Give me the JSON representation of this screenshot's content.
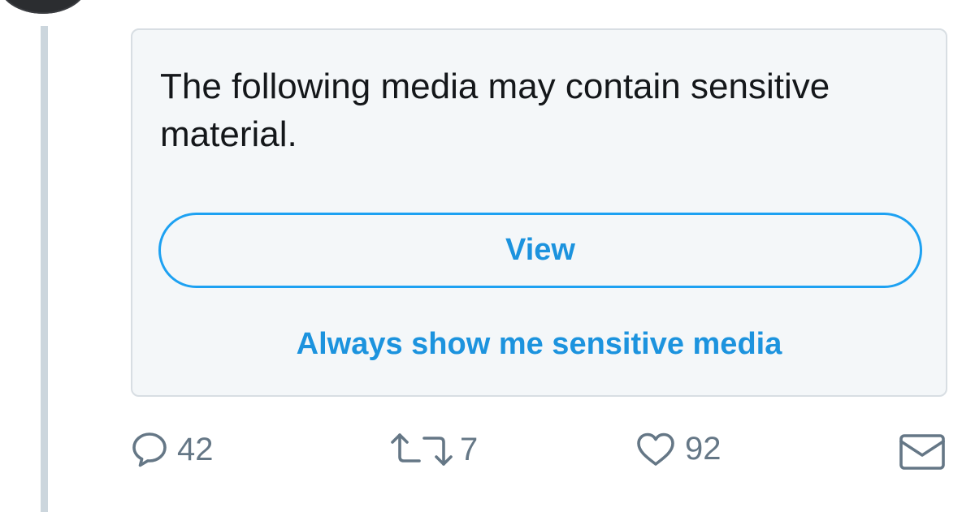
{
  "sensitive_notice": {
    "message": "The following media may contain sensitive material.",
    "view_label": "View",
    "always_show_label": "Always show me sensitive media"
  },
  "actions": {
    "reply": {
      "icon": "reply-icon",
      "count": "42"
    },
    "retweet": {
      "icon": "retweet-icon",
      "count": "7"
    },
    "like": {
      "icon": "heart-icon",
      "count": "92"
    },
    "message": {
      "icon": "envelope-icon"
    }
  },
  "colors": {
    "accent": "#1da1f2",
    "link": "#1c93de",
    "card_background": "#f4f7f9",
    "card_border": "#d8dee3",
    "thread_line": "#ccd6dd",
    "action_gray": "#657786",
    "text": "#14171a"
  }
}
